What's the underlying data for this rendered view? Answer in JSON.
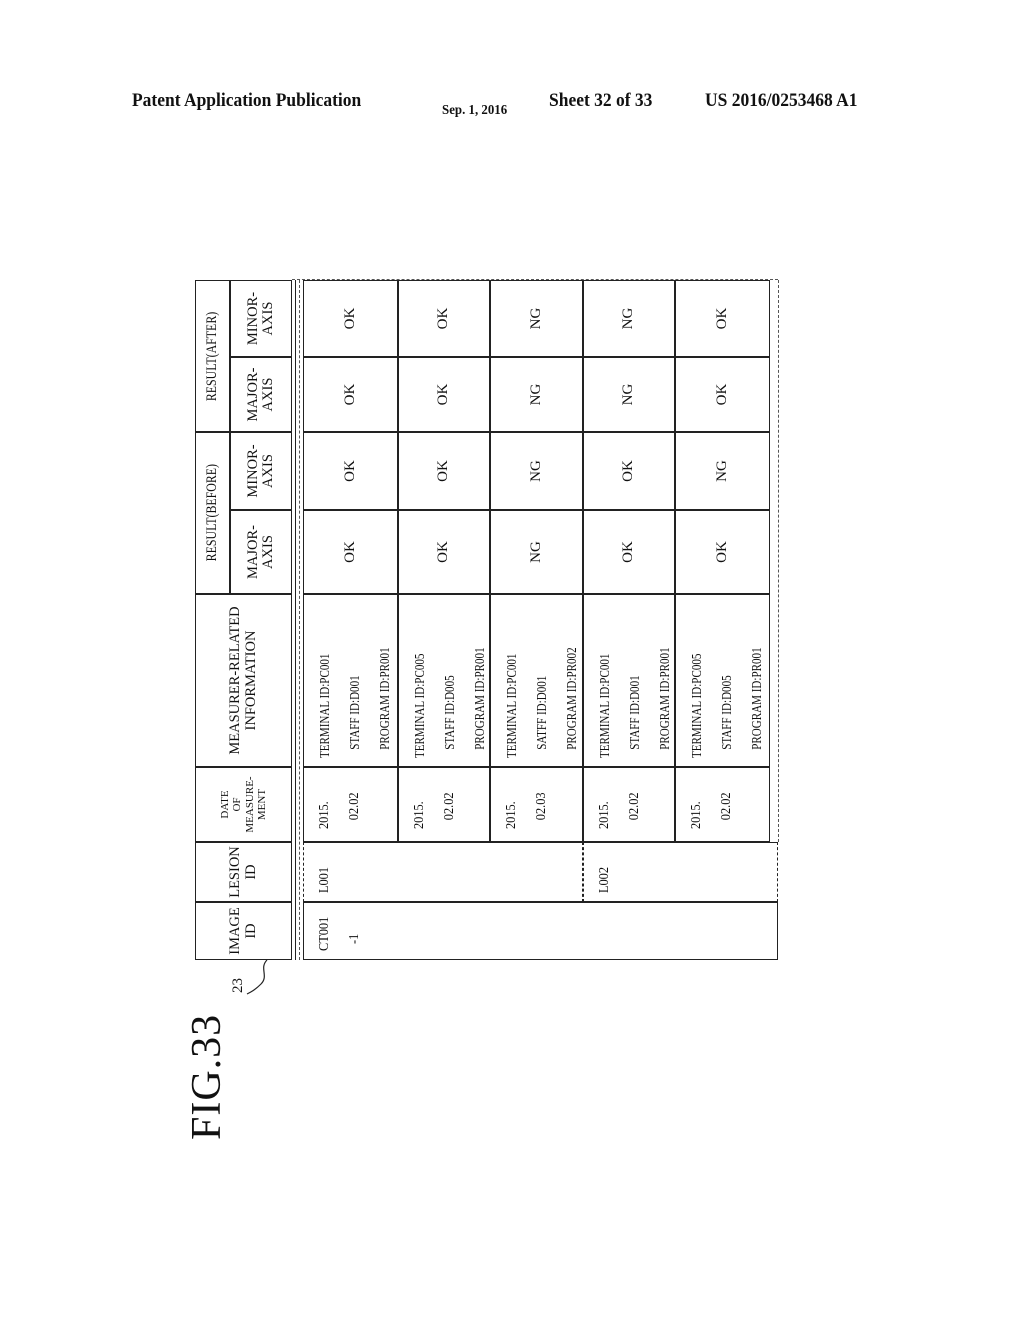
{
  "header": {
    "publication": "Patent Application Publication",
    "date": "Sep. 1, 2016",
    "sheet": "Sheet 32 of 33",
    "number": "US 2016/0253468 A1"
  },
  "figure": {
    "label": "FIG.33",
    "reference": "23"
  },
  "table": {
    "headers": {
      "image_id": "IMAGE ID",
      "lesion_id": "LESION ID",
      "date": [
        "DATE",
        "OF",
        "MEASURE-",
        "MENT"
      ],
      "measurer": [
        "MEASURER-RELATED",
        "INFORMATION"
      ],
      "result_before": "RESULT(BEFORE)",
      "result_after": "RESULT(AFTER)",
      "major_axis": [
        "MAJOR-",
        "AXIS"
      ],
      "minor_axis": [
        "MINOR-",
        "AXIS"
      ]
    },
    "image_id": [
      "CT001",
      "-1"
    ],
    "lesions": [
      {
        "id": "L001",
        "rows": [
          0,
          1,
          2
        ]
      },
      {
        "id": "L002",
        "rows": [
          3,
          4
        ]
      }
    ],
    "rows": [
      {
        "date": [
          "2015.",
          "02.02"
        ],
        "terminal": "TERMINAL ID:PC001",
        "staff": "STAFF ID:D001",
        "program": "PROGRAM ID:PR001",
        "before_major": "OK",
        "before_minor": "OK",
        "after_major": "OK",
        "after_minor": "OK"
      },
      {
        "date": [
          "2015.",
          "02.02"
        ],
        "terminal": "TERMINAL ID:PC005",
        "staff": "STAFF ID:D005",
        "program": "PROGRAM ID:PR001",
        "before_major": "OK",
        "before_minor": "OK",
        "after_major": "OK",
        "after_minor": "OK"
      },
      {
        "date": [
          "2015.",
          "02.03"
        ],
        "terminal": "TERMINAL ID:PC001",
        "staff": "SATFF ID:D001",
        "program": "PROGRAM ID:PR002",
        "before_major": "NG",
        "before_minor": "NG",
        "after_major": "NG",
        "after_minor": "NG"
      },
      {
        "date": [
          "2015.",
          "02.02"
        ],
        "terminal": "TERMINAL ID:PC001",
        "staff": "STAFF ID:D001",
        "program": "PROGRAM ID:PR001",
        "before_major": "OK",
        "before_minor": "OK",
        "after_major": "NG",
        "after_minor": "NG"
      },
      {
        "date": [
          "2015.",
          "02.02"
        ],
        "terminal": "TERMINAL ID:PC005",
        "staff": "STAFF ID:D005",
        "program": "PROGRAM ID:PR001",
        "before_major": "OK",
        "before_minor": "NG",
        "after_major": "OK",
        "after_minor": "OK"
      }
    ]
  }
}
